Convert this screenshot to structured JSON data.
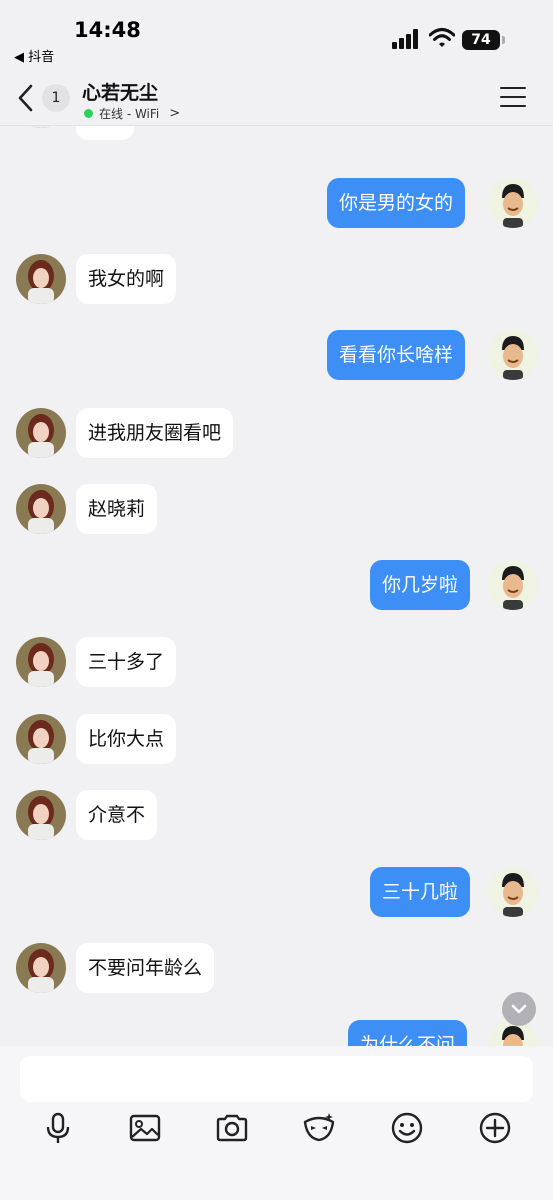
{
  "status_bar": {
    "time": "14:48",
    "back_app": "◀ 抖音",
    "battery": "74"
  },
  "header": {
    "unread_count": "1",
    "contact_name": "心若无尘",
    "status": "在线 - WiFi",
    "status_color": "#2bd25a"
  },
  "messages": [
    {
      "side": "out",
      "text": "你是男的女的"
    },
    {
      "side": "in",
      "text": "我女的啊"
    },
    {
      "side": "out",
      "text": "看看你长啥样"
    },
    {
      "side": "in",
      "text": "进我朋友圈看吧"
    },
    {
      "side": "in",
      "text": "赵晓莉"
    },
    {
      "side": "out",
      "text": "你几岁啦"
    },
    {
      "side": "in",
      "text": "三十多了"
    },
    {
      "side": "in",
      "text": "比你大点"
    },
    {
      "side": "in",
      "text": "介意不"
    },
    {
      "side": "out",
      "text": "三十几啦"
    },
    {
      "side": "in",
      "text": "不要问年龄么"
    },
    {
      "side": "out",
      "text": "为什么不问"
    }
  ],
  "partial_message": {
    "side": "in",
    "content": "emoji"
  },
  "composer": {
    "placeholder": ""
  },
  "toolbar": [
    "microphone-icon",
    "image-icon",
    "camera-icon",
    "mask-icon",
    "emoji-icon",
    "plus-icon"
  ],
  "colors": {
    "outgoing_bubble": "#3d8ef5",
    "incoming_bubble": "#ffffff",
    "background": "#f1f1f3"
  }
}
